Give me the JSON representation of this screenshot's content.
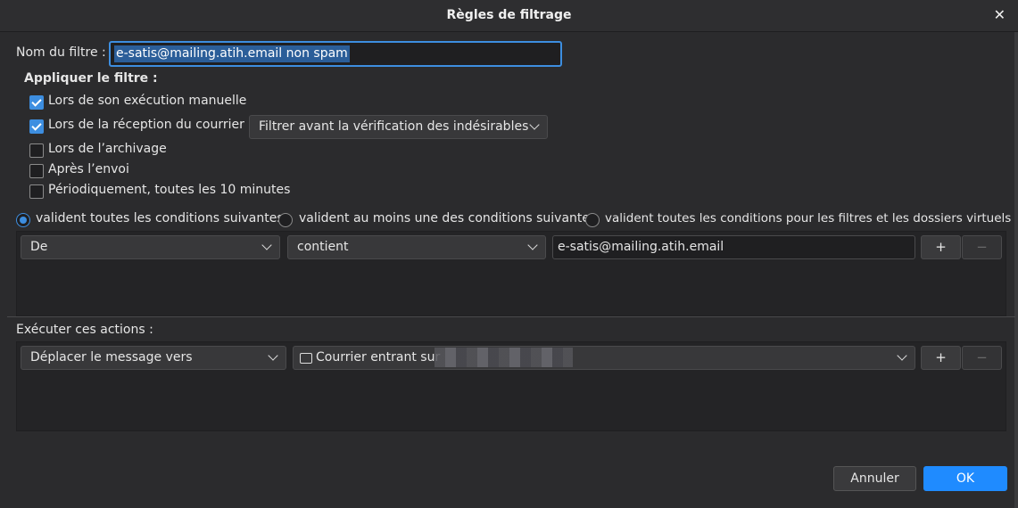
{
  "window": {
    "title": "Règles de filtrage"
  },
  "filter_name": {
    "label": "Nom du filtre :",
    "value": "e-satis@mailing.atih.email non spam"
  },
  "apply_filter": {
    "heading": "Appliquer le filtre :",
    "options": [
      {
        "label": "Lors de son exécution manuelle",
        "checked": true
      },
      {
        "label": "Lors de la réception du courrier :",
        "checked": true
      },
      {
        "label": "Lors de l’archivage",
        "checked": false
      },
      {
        "label": "Après l’envoi",
        "checked": false
      },
      {
        "label": "Périodiquement, toutes les 10 minutes",
        "checked": false
      }
    ],
    "reception_dropdown": "Filtrer avant la vérification des indésirables"
  },
  "match_mode": {
    "options": [
      {
        "label": "valident toutes les conditions suivantes",
        "selected": true
      },
      {
        "label": "valident au moins une des conditions suivantes",
        "selected": false
      },
      {
        "label": "valident toutes les conditions pour les filtres et les dossiers virtuels",
        "selected": false
      }
    ]
  },
  "conditions": [
    {
      "field": "De",
      "operator": "contient",
      "value": "e-satis@mailing.atih.email"
    }
  ],
  "actions_section": {
    "label": "Exécuter ces actions :",
    "actions": [
      {
        "type": "Déplacer le message vers",
        "target": "Courrier entrant sur"
      }
    ]
  },
  "buttons": {
    "add": "+",
    "remove": "−",
    "cancel": "Annuler",
    "ok": "OK",
    "close": "✕"
  },
  "colors": {
    "accent": "#3d8ee0",
    "ok_button": "#1f8bff",
    "background": "#2b2b2d"
  }
}
